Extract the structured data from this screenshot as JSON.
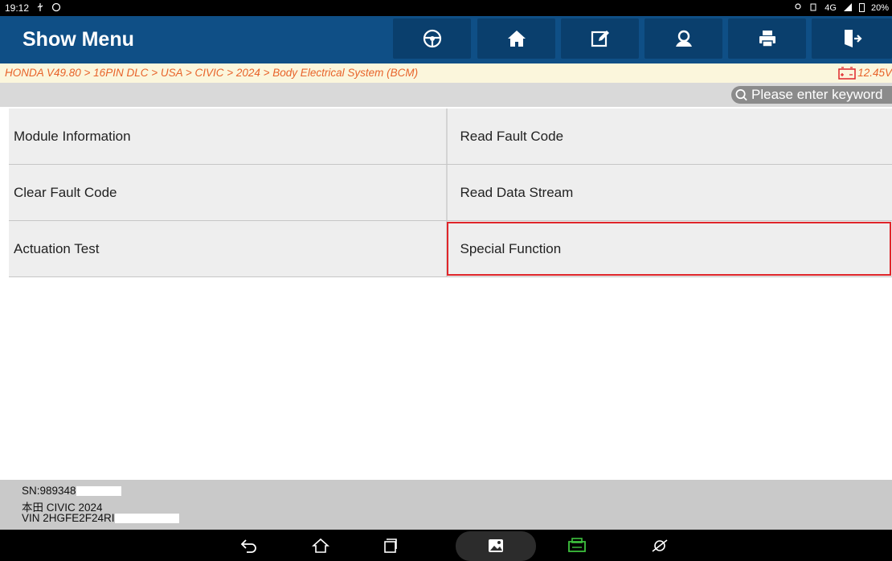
{
  "status": {
    "time": "19:12",
    "right_text": "4G",
    "battery": "20%"
  },
  "header": {
    "title": "Show Menu"
  },
  "breadcrumb": {
    "path": "HONDA V49.80 > 16PIN DLC > USA > CIVIC > 2024 > Body Electrical System (BCM)",
    "voltage": "12.45V"
  },
  "search": {
    "placeholder": "Please enter keyword"
  },
  "menu": [
    "Module Information",
    "Read Fault Code",
    "Clear Fault Code",
    "Read Data Stream",
    "Actuation Test",
    "Special Function"
  ],
  "selected_item": "Special Function",
  "info": {
    "sn": "SN:989348",
    "model": "本田 CIVIC 2024",
    "vin": "VIN 2HGFE2F24RI"
  },
  "colors": {
    "header": "#0f4f86",
    "button": "#0a3f6d",
    "breadcrumb_text": "#e8632a",
    "breadcrumb_bg": "#fbf6dc",
    "selection": "#e0252a"
  }
}
